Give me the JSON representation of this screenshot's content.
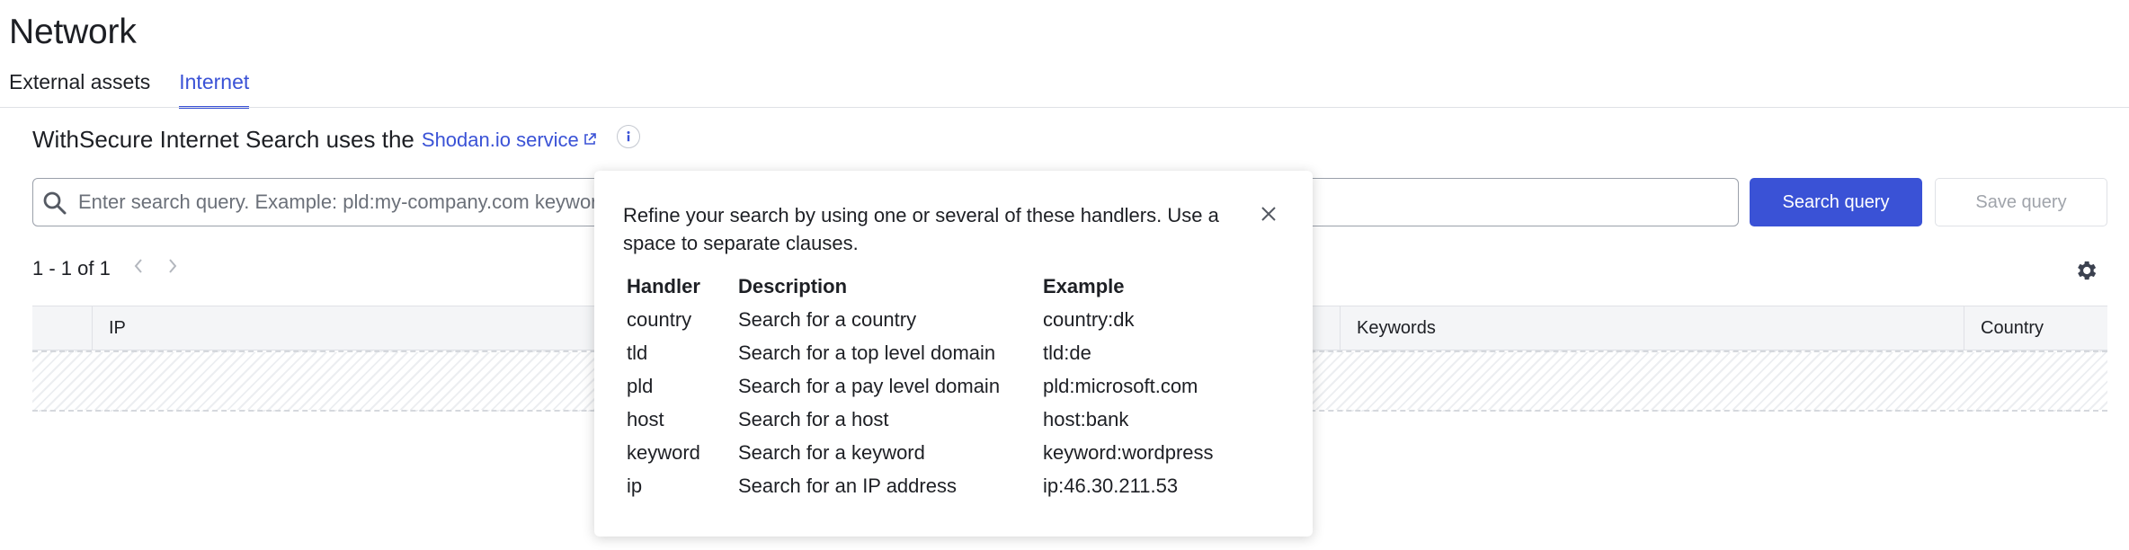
{
  "page": {
    "title": "Network"
  },
  "tabs": [
    {
      "label": "External assets",
      "active": false
    },
    {
      "label": "Internet",
      "active": true
    }
  ],
  "info": {
    "text": "WithSecure Internet Search uses the",
    "link_label": "Shodan.io service"
  },
  "search": {
    "placeholder": "Enter search query. Example: pld:my-company.com keyword:wordpress",
    "value": "",
    "submit_label": "Search query",
    "save_label": "Save query"
  },
  "pagination": {
    "label": "1 - 1 of 1"
  },
  "table": {
    "columns": [
      "",
      "IP",
      "Keywords",
      "Country"
    ]
  },
  "popover": {
    "intro": "Refine your search by using one or several of these handlers. Use a space to separate clauses.",
    "headers": [
      "Handler",
      "Description",
      "Example"
    ],
    "rows": [
      [
        "country",
        "Search for a country",
        "country:dk"
      ],
      [
        "tld",
        "Search for a top level domain",
        "tld:de"
      ],
      [
        "pld",
        "Search for a pay level domain",
        "pld:microsoft.com"
      ],
      [
        "host",
        "Search for a host",
        "host:bank"
      ],
      [
        "keyword",
        "Search for a keyword",
        "keyword:wordpress"
      ],
      [
        "ip",
        "Search for an IP address",
        "ip:46.30.211.53"
      ]
    ]
  },
  "colors": {
    "accent": "#3a52d6",
    "text": "#1d1f24",
    "muted": "#6b7079",
    "border": "#dfe1e6"
  },
  "icons": [
    "external-link-icon",
    "info-icon",
    "search-icon",
    "chevron-left-icon",
    "chevron-right-icon",
    "gear-icon",
    "close-icon"
  ]
}
